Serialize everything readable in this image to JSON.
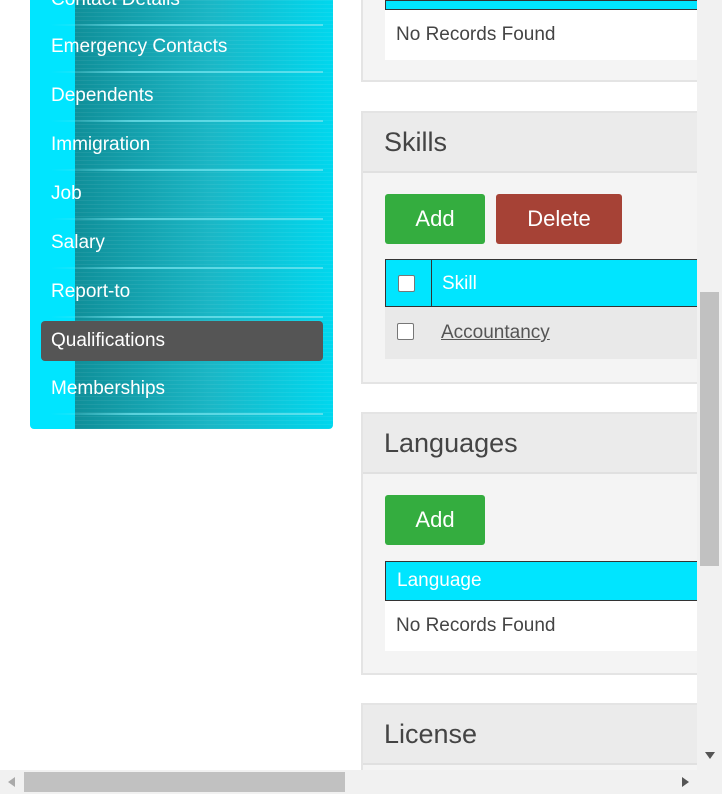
{
  "sidebar": {
    "items": [
      {
        "label": "Contact Details"
      },
      {
        "label": "Emergency Contacts"
      },
      {
        "label": "Dependents"
      },
      {
        "label": "Immigration"
      },
      {
        "label": "Job"
      },
      {
        "label": "Salary"
      },
      {
        "label": "Report-to"
      },
      {
        "label": "Qualifications",
        "active": true
      },
      {
        "label": "Memberships"
      }
    ]
  },
  "top_panel": {
    "empty_text": "No Records Found"
  },
  "skills": {
    "title": "Skills",
    "add_label": "Add",
    "delete_label": "Delete",
    "column_header": "Skill",
    "rows": [
      {
        "skill": "Accountancy"
      }
    ]
  },
  "languages": {
    "title": "Languages",
    "add_label": "Add",
    "column_header": "Language",
    "empty_text": "No Records Found"
  },
  "license": {
    "title": "License"
  },
  "colors": {
    "accent": "#00e5ff",
    "add_button": "#34ad3f",
    "delete_button": "#a64236",
    "active_nav": "#555555"
  }
}
